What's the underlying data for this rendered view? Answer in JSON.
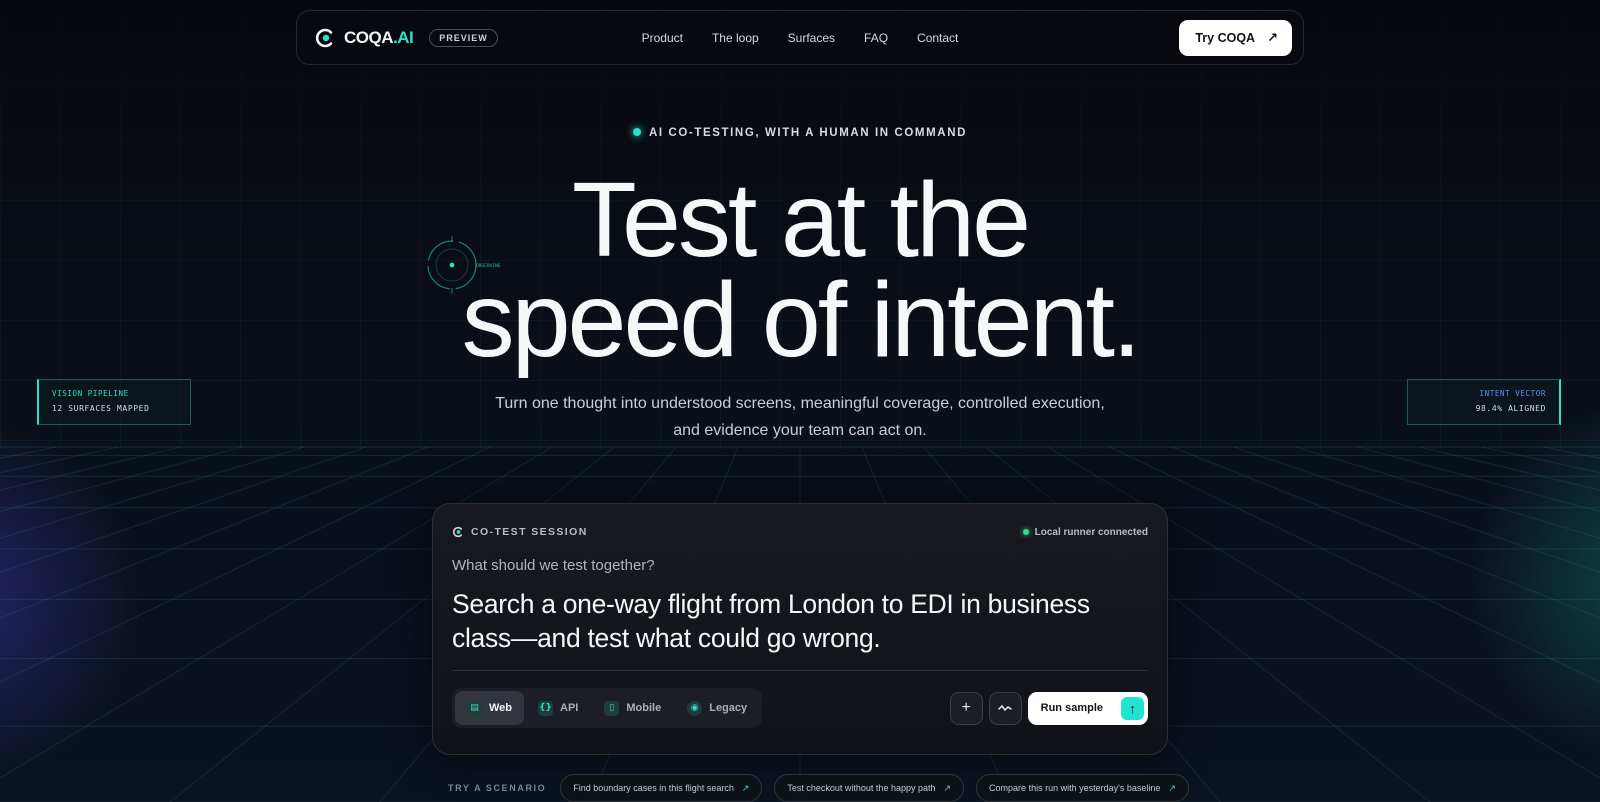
{
  "nav": {
    "brand_main": "COQA",
    "brand_ai": ".AI",
    "badge": "PREVIEW",
    "links": [
      "Product",
      "The loop",
      "Surfaces",
      "FAQ",
      "Contact"
    ],
    "cta": "Try COQA",
    "cta_icon": "arrow-up-right-icon"
  },
  "hero": {
    "eyebrow": "AI CO-TESTING, WITH A HUMAN IN COMMAND",
    "headline_line1": "Test at the",
    "headline_line2": "speed of intent.",
    "subtitle_line1": "Turn one thought into understood screens, meaningful coverage, controlled execution,",
    "subtitle_line2": "and evidence your team can act on.",
    "hud_label": "OBSERVING"
  },
  "panels": {
    "left": {
      "key": "VISION PIPELINE",
      "value": "12 SURFACES MAPPED"
    },
    "right": {
      "key": "INTENT VECTOR",
      "value": "98.4% ALIGNED"
    }
  },
  "session": {
    "title": "CO-TEST SESSION",
    "status": "Local runner connected",
    "question": "What should we test together?",
    "prompt_line1": "Search a one-way flight from London to EDI in business",
    "prompt_line2": "class—and test what could go wrong.",
    "surfaces": [
      {
        "label": "Web",
        "icon": "browser-icon",
        "active": true
      },
      {
        "label": "API",
        "icon": "braces-icon",
        "active": false
      },
      {
        "label": "Mobile",
        "icon": "phone-icon",
        "active": false
      },
      {
        "label": "Legacy",
        "icon": "legacy-icon",
        "active": false
      }
    ],
    "add_label": "+",
    "run_label": "Run sample",
    "accent": "#2de0c8"
  },
  "scenarios": {
    "label": "TRY A SCENARIO",
    "items": [
      "Find boundary cases in this flight search",
      "Test checkout without the happy path",
      "Compare this run with yesterday's baseline"
    ]
  }
}
